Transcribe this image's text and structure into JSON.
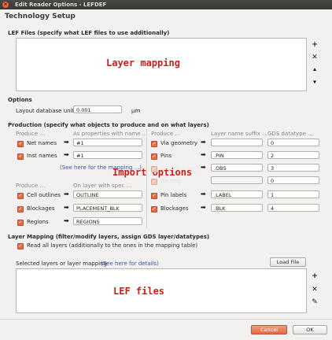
{
  "window": {
    "title": "Edit Reader Options - LEFDEF",
    "close_glyph": "×"
  },
  "page_title": "Technology Setup",
  "lef_files": {
    "heading": "LEF Files (specify what LEF files to use additionally)",
    "overlay": "Layer mapping",
    "buttons": {
      "add": "+",
      "remove": "✕",
      "up": "⯅",
      "down": "⯆"
    }
  },
  "options": {
    "heading": "Options",
    "dbu_label": "Layout database unit",
    "dbu_value": "0.001",
    "dbu_unit": "µm"
  },
  "production": {
    "heading": "Production (specify what objects to produce and on what layers)",
    "left_header_produce": "Produce ...",
    "left_header_props": "As properties with name ...",
    "right_header_produce": "Produce ...",
    "right_header_suffix": "Layer name suffix ...",
    "right_header_datatype": "GDS datatype ...",
    "left_rows": [
      {
        "label": "Net names",
        "value": "#1"
      },
      {
        "label": "Inst names",
        "value": "#1"
      }
    ],
    "help_link": "(See here for the mapping ...)",
    "overlay": "Import options",
    "right_rows": [
      {
        "label": "Via geometry",
        "suffix": "",
        "datatype": "0"
      },
      {
        "label": "Pins",
        "suffix": ".PIN",
        "datatype": "2"
      },
      {
        "label": "Obstructions",
        "suffix": ".OBS",
        "datatype": "3"
      },
      {
        "label": "Routing",
        "suffix": "",
        "datatype": "0"
      },
      {
        "label": "Pin labels",
        "suffix": ".LABEL",
        "datatype": "1"
      },
      {
        "label": "Blockages",
        "suffix": ".BLK",
        "datatype": "4"
      }
    ],
    "lower_left_header_produce": "Produce ...",
    "lower_left_header_layer": "On layer with spec ...",
    "lower_left_rows": [
      {
        "label": "Cell outlines",
        "value": "OUTLINE"
      },
      {
        "label": "Blockages",
        "value": "PLACEMENT_BLK"
      },
      {
        "label": "Regions",
        "value": "REGIONS"
      }
    ]
  },
  "layer_mapping": {
    "heading": "Layer Mapping (filter/modify layers, assign GDS layer/datatypes)",
    "read_all_label": "Read all layers (additionally to the ones in the mapping table)",
    "selected_label": "Selected layers or layer mapping",
    "selected_link": "(See here for details)",
    "load_file": "Load File",
    "overlay": "LEF files",
    "buttons": {
      "add": "+",
      "remove": "✕",
      "edit": "✎"
    }
  },
  "footer": {
    "cancel": "Cancel",
    "ok": "OK"
  },
  "colors": {
    "accent": "#e06d45",
    "overlay_text": "#cc1f1a",
    "link": "#3355aa"
  }
}
